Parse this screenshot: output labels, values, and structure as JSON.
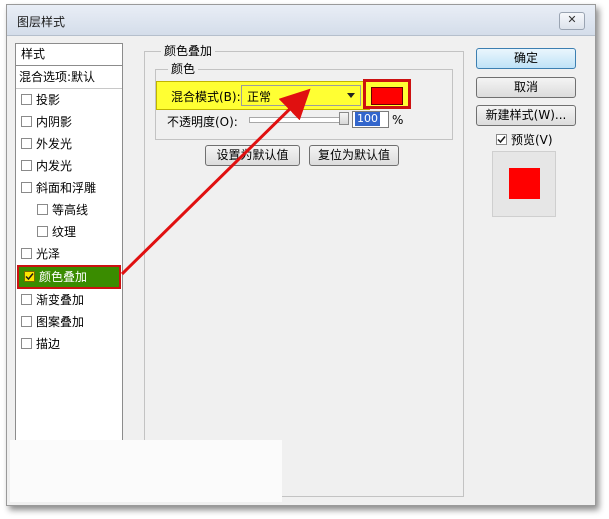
{
  "dialog": {
    "title": "图层样式",
    "close_glyph": "✕"
  },
  "left_panel": {
    "header": "样式",
    "blend_options": "混合选项:默认",
    "items": [
      {
        "label": "投影",
        "checked": false,
        "sub": false
      },
      {
        "label": "内阴影",
        "checked": false,
        "sub": false
      },
      {
        "label": "外发光",
        "checked": false,
        "sub": false
      },
      {
        "label": "内发光",
        "checked": false,
        "sub": false
      },
      {
        "label": "斜面和浮雕",
        "checked": false,
        "sub": false
      },
      {
        "label": "等高线",
        "checked": false,
        "sub": true
      },
      {
        "label": "纹理",
        "checked": false,
        "sub": true
      },
      {
        "label": "光泽",
        "checked": false,
        "sub": false
      },
      {
        "label": "颜色叠加",
        "checked": true,
        "sub": false,
        "active": true
      },
      {
        "label": "渐变叠加",
        "checked": false,
        "sub": false
      },
      {
        "label": "图案叠加",
        "checked": false,
        "sub": false
      },
      {
        "label": "描边",
        "checked": false,
        "sub": false
      }
    ]
  },
  "color_overlay": {
    "group_title": "颜色叠加",
    "subgroup_title": "颜色",
    "blend_mode_label": "混合模式(B):",
    "blend_mode_value": "正常",
    "overlay_color": "#ff0000",
    "opacity_label": "不透明度(O):",
    "opacity_value": "100",
    "opacity_unit": "%",
    "opacity_percent": 100,
    "set_default_button": "设置为默认值",
    "reset_default_button": "复位为默认值"
  },
  "actions": {
    "ok": "确定",
    "cancel": "取消",
    "new_style": "新建样式(W)...",
    "preview_label": "预览(V)",
    "preview_checked": true
  },
  "annotation": {
    "highlight_color": "#ffff33",
    "arrow_color": "#e01010",
    "active_item_color": "#3a8c00"
  }
}
